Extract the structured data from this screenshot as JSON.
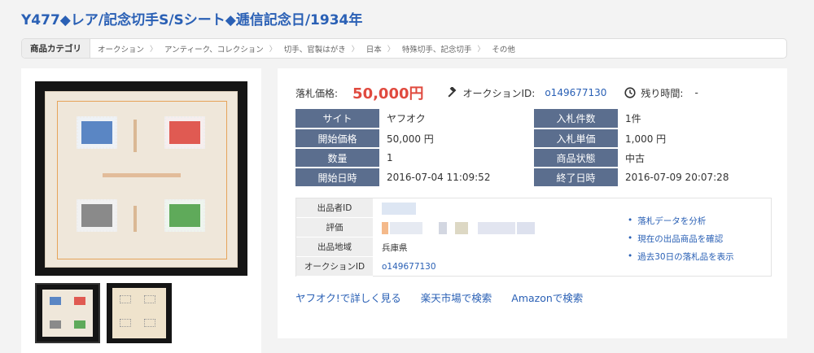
{
  "page": {
    "title": "Y477◆レア/記念切手S/Sシート◆逓信記念日/1934年"
  },
  "breadcrumb": {
    "head": "商品カテゴリ",
    "items": [
      "オークション",
      "アンティーク、コレクション",
      "切手、官製はがき",
      "日本",
      "特殊切手、記念切手",
      "その他"
    ]
  },
  "price": {
    "label": "落札価格:",
    "value": "50,000円",
    "auction_id_label": "オークションID:",
    "auction_id_value": "o149677130",
    "remaining_label": "残り時間:",
    "remaining_value": "-"
  },
  "info": {
    "rows": [
      {
        "k1": "サイト",
        "v1": "ヤフオク",
        "k2": "入札件数",
        "v2": "1件"
      },
      {
        "k1": "開始価格",
        "v1": "50,000 円",
        "k2": "入札単価",
        "v2": "1,000 円"
      },
      {
        "k1": "数量",
        "v1": "1",
        "k2": "商品状態",
        "v2": "中古"
      },
      {
        "k1": "開始日時",
        "v1": "2016-07-04 11:09:52",
        "k2": "終了日時",
        "v2": "2016-07-09 20:07:28"
      }
    ]
  },
  "seller": {
    "id_label": "出品者ID",
    "rating_label": "評価",
    "region_label": "出品地域",
    "region_value": "兵庫県",
    "auction_id_label": "オークションID",
    "auction_id_value": "o149677130",
    "links": [
      "落札データを分析",
      "現在の出品商品を確認",
      "過去30日の落札品を表示"
    ]
  },
  "bottom_links": [
    "ヤフオク!で詳しく見る",
    "楽天市場で検索",
    "Amazonで検索"
  ],
  "colors": {
    "accent": "#2a60b5",
    "price": "#e04a3f",
    "table_header": "#5b6e8e"
  },
  "icons": {
    "auction": "gavel-icon",
    "clock": "clock-icon"
  }
}
